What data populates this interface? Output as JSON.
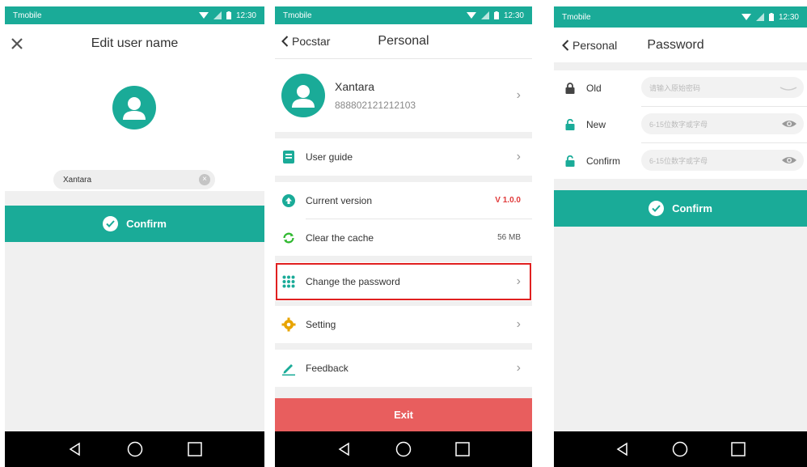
{
  "status": {
    "carrier": "Tmobile",
    "time": "12:30"
  },
  "panel1": {
    "title": "Edit user name",
    "name_value": "Xantara",
    "confirm_label": "Confirm"
  },
  "panel2": {
    "back_label": "Pocstar",
    "title": "Personal",
    "profile": {
      "name": "Xantara",
      "number": "888802121212103"
    },
    "items": [
      {
        "label": "User guide"
      },
      {
        "label": "Current version",
        "value": "V 1.0.0"
      },
      {
        "label": "Clear the cache",
        "value": "56 MB"
      },
      {
        "label": "Change the password"
      },
      {
        "label": "Setting"
      },
      {
        "label": "Feedback"
      }
    ],
    "exit_label": "Exit"
  },
  "panel3": {
    "back_label": "Personal",
    "title": "Password",
    "fields": [
      {
        "label": "Old",
        "placeholder": "请输入原始密码"
      },
      {
        "label": "New",
        "placeholder": "6-15位数字或字母"
      },
      {
        "label": "Confirm",
        "placeholder": "6-15位数字或字母"
      }
    ],
    "confirm_label": "Confirm"
  },
  "colors": {
    "accent": "#1aab98",
    "exit": "#e85e5e",
    "version": "#e03a3a",
    "highlight": "#e02020",
    "setting": "#e8a400"
  },
  "icons": [
    "close-icon",
    "user-icon",
    "clear-icon",
    "check-icon",
    "chevron-left-icon",
    "chevron-right-icon",
    "guide-icon",
    "upload-icon",
    "refresh-icon",
    "grid-icon",
    "gear-icon",
    "pencil-icon",
    "lock-icon",
    "eye-icon",
    "back-triangle-icon",
    "home-circle-icon",
    "recents-square-icon"
  ]
}
